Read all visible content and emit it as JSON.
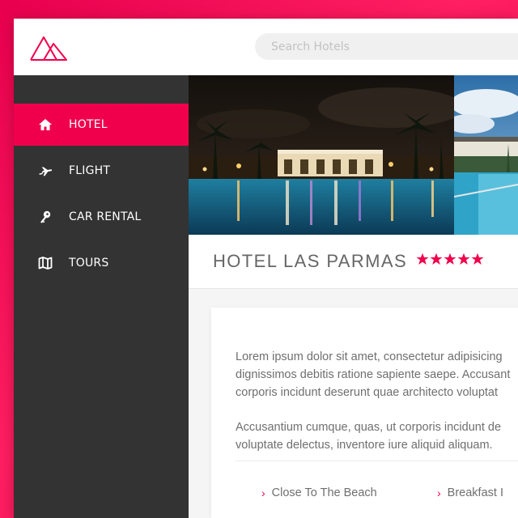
{
  "brand": {
    "accent": "#f0004c",
    "sidebar_bg": "#333333",
    "logo_icon": "mountain-logo-icon"
  },
  "search": {
    "placeholder": "Search Hotels"
  },
  "sidebar": {
    "items": [
      {
        "label": "HOTEL",
        "icon": "home-icon",
        "active": true
      },
      {
        "label": "FLIGHT",
        "icon": "plane-icon",
        "active": false
      },
      {
        "label": "CAR RENTAL",
        "icon": "key-icon",
        "active": false
      },
      {
        "label": "TOURS",
        "icon": "map-icon",
        "active": false
      }
    ]
  },
  "hotel": {
    "name": "HOTEL LAS PARMAS",
    "rating": 5,
    "rating_max": 5
  },
  "description": {
    "paragraph1_lines": [
      "Lorem ipsum dolor sit amet, consectetur adipisicing",
      "dignissimos debitis ratione sapiente saepe. Accusant",
      "corporis incidunt deserunt quae architecto voluptat"
    ],
    "paragraph2_lines": [
      "Accusantium cumque, quas, ut corporis incidunt de",
      "voluptate delectus, inventore iure aliquid aliquam."
    ]
  },
  "features": [
    {
      "label": "Close To The Beach",
      "icon": "chevron-right-icon"
    },
    {
      "label": "Breakfast I",
      "icon": "chevron-right-icon"
    }
  ]
}
